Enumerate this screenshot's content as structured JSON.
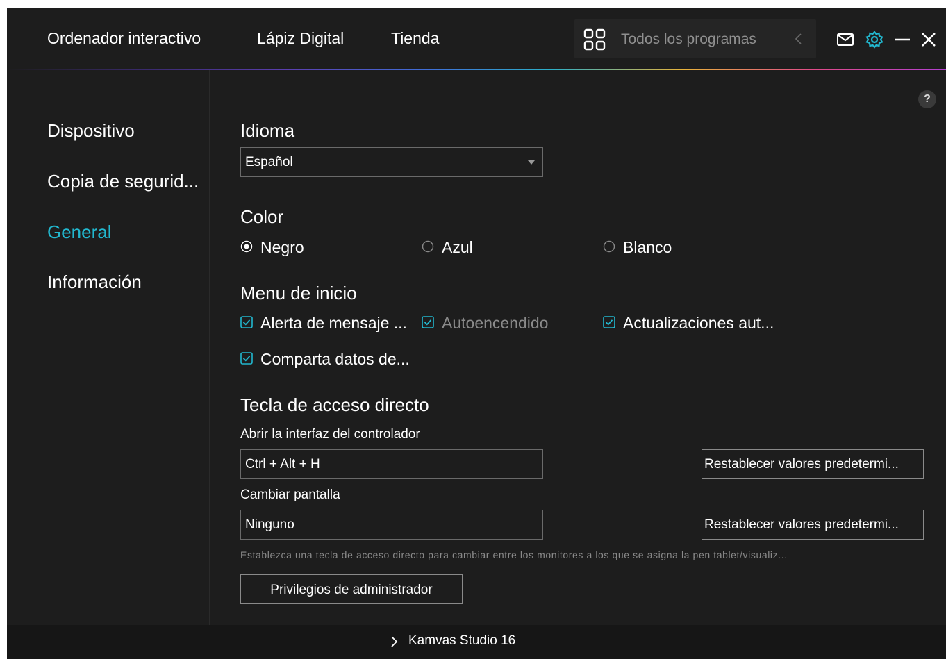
{
  "header": {
    "tabs": [
      "Ordenador interactivo",
      "Lápiz Digital",
      "Tienda"
    ],
    "programs_label": "Todos los programas"
  },
  "sidebar": {
    "items": [
      {
        "label": "Dispositivo",
        "active": false
      },
      {
        "label": "Copia de segurid...",
        "active": false
      },
      {
        "label": "General",
        "active": true
      },
      {
        "label": "Información",
        "active": false
      }
    ]
  },
  "language": {
    "title": "Idioma",
    "selected": "Español"
  },
  "color": {
    "title": "Color",
    "options": [
      {
        "label": "Negro",
        "selected": true
      },
      {
        "label": "Azul",
        "selected": false
      },
      {
        "label": "Blanco",
        "selected": false
      }
    ]
  },
  "startup": {
    "title": "Menu de inicio",
    "options": [
      {
        "label": "Alerta de mensaje ...",
        "checked": true,
        "disabled": false
      },
      {
        "label": "Autoencendido",
        "checked": true,
        "disabled": true
      },
      {
        "label": "Actualizaciones aut...",
        "checked": true,
        "disabled": false
      },
      {
        "label": "Comparta datos de...",
        "checked": true,
        "disabled": false
      }
    ]
  },
  "hotkeys": {
    "title": "Tecla de acceso directo",
    "items": [
      {
        "label": "Abrir la interfaz del controlador",
        "value": "Ctrl + Alt + H",
        "reset_label": "Restablecer valores predetermi..."
      },
      {
        "label": "Cambiar pantalla",
        "value": "Ninguno",
        "reset_label": "Restablecer valores predetermi..."
      }
    ],
    "hint": "Establezca una tecla de acceso directo para cambiar entre los monitores a los que se asigna la pen tablet/visualiz..."
  },
  "admin_button": "Privilegios de administrador",
  "help_label": "?",
  "footer": {
    "device": "Kamvas Studio 16"
  },
  "colors": {
    "accent": "#22b8cf",
    "background": "#1d1d1d",
    "footer": "#161616"
  }
}
